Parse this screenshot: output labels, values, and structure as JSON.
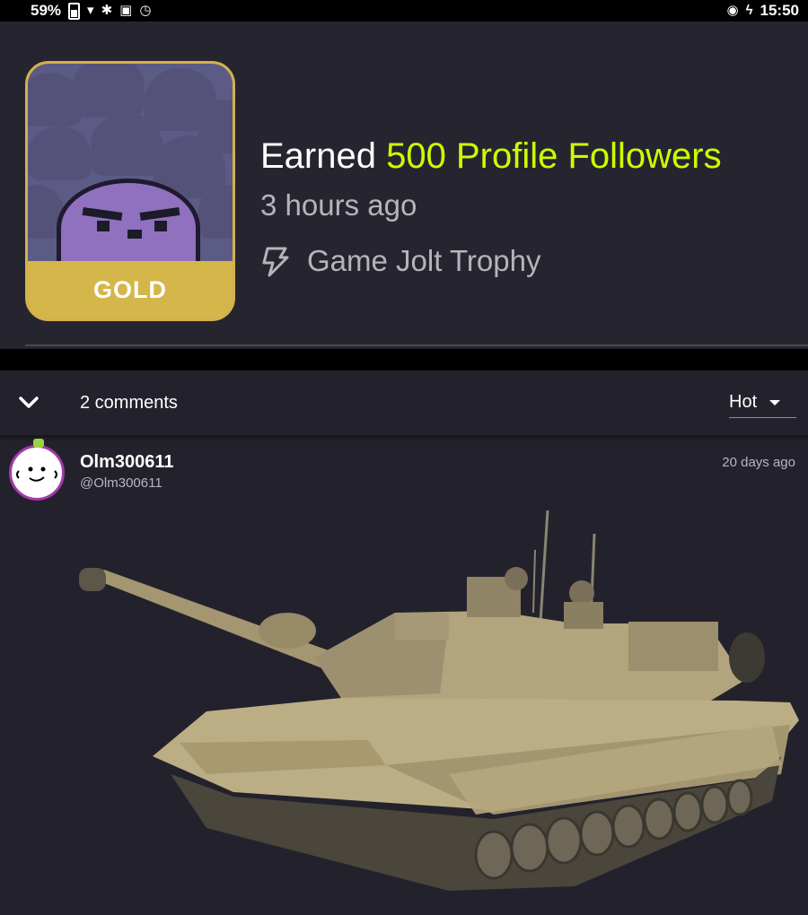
{
  "status_bar": {
    "battery_percent": "59%",
    "time": "15:50",
    "icons": [
      "battery-icon",
      "wifi-icon",
      "bluetooth-icon",
      "cast-icon",
      "sync-icon",
      "data-saver-icon",
      "charging-bolt-icon"
    ]
  },
  "trophy": {
    "badge_tier": "GOLD",
    "title_prefix": "Earned",
    "title_accent": "500 Profile Followers",
    "time_ago": "3 hours ago",
    "source": "Game Jolt Trophy",
    "colors": {
      "accent": "#ccff00",
      "badge": "#d4b64a",
      "panel": "#26252f"
    }
  },
  "comments": {
    "count_label": "2 comments",
    "sort_value": "Hot",
    "items": [
      {
        "username": "Olm300611",
        "handle": "@Olm300611",
        "date": "20 days ago",
        "image": "tank-photo"
      }
    ]
  }
}
